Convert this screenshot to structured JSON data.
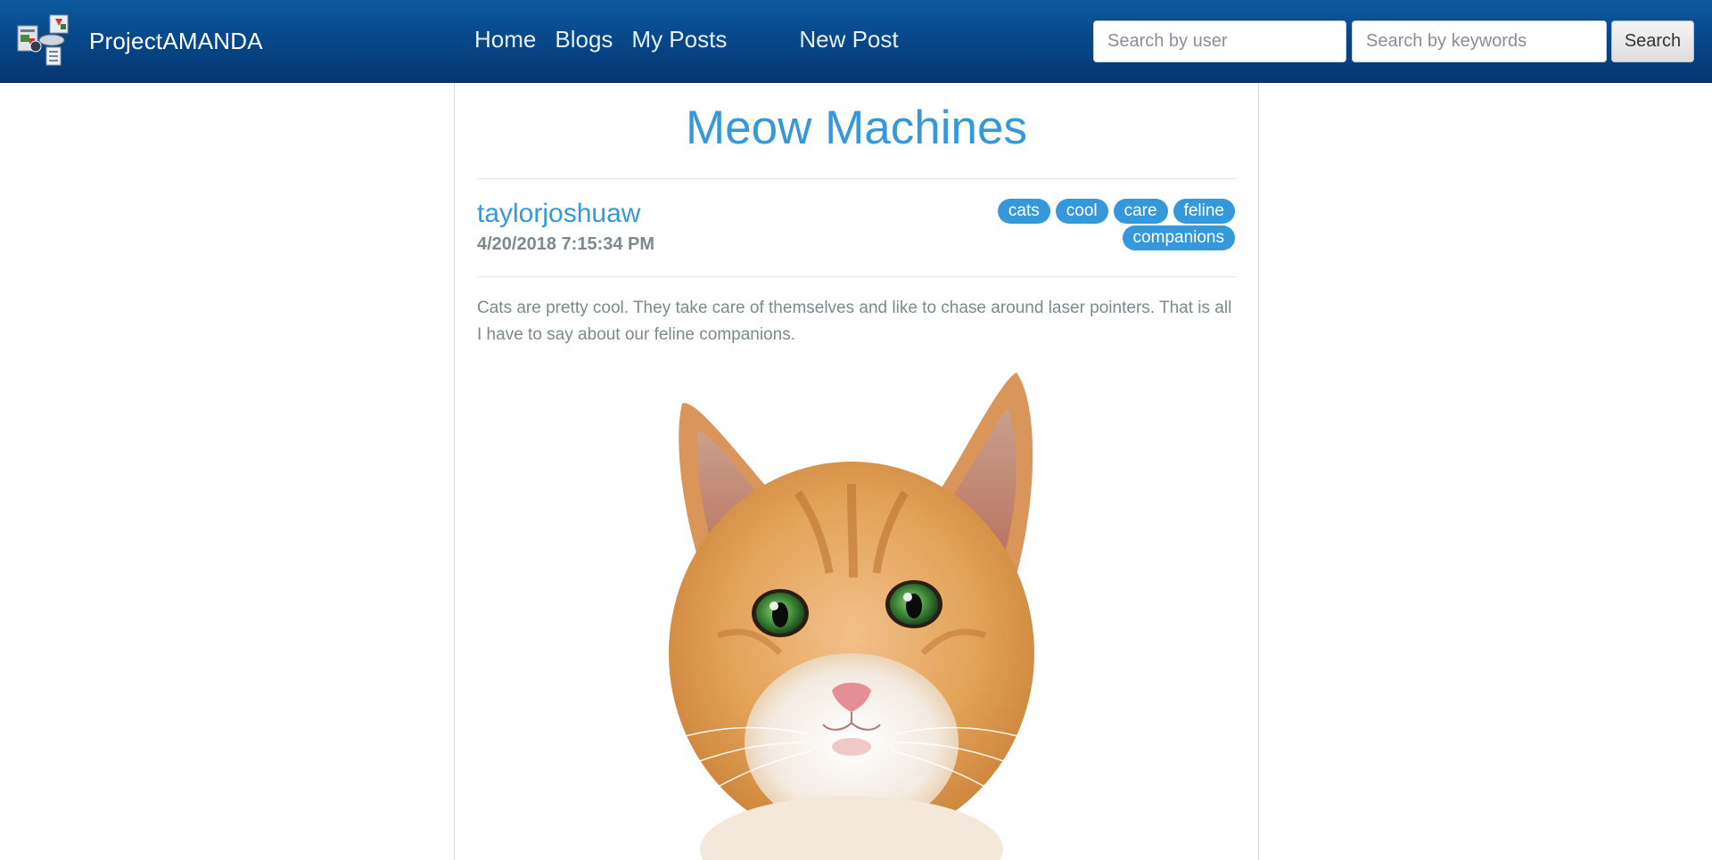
{
  "navbar": {
    "brand": "ProjectAMANDA",
    "links": [
      "Home",
      "Blogs",
      "My Posts",
      "New Post"
    ],
    "search_user_placeholder": "Search by user",
    "search_keywords_placeholder": "Search by keywords",
    "search_button": "Search"
  },
  "post": {
    "title": "Meow Machines",
    "author": "taylorjoshuaw",
    "timestamp": "4/20/2018 7:15:34 PM",
    "tags": [
      "cats",
      "cool",
      "care",
      "feline",
      "companions"
    ],
    "body": "Cats are pretty cool. They take care of themselves and like to chase around laser pointers. That is all I have to say about our feline companions.",
    "image_icon": "kitten-photo"
  },
  "colors": {
    "navbar_top": "#0d5aa0",
    "navbar_bottom": "#053672",
    "accent": "#3498db",
    "muted_text": "#7b8a8b"
  }
}
